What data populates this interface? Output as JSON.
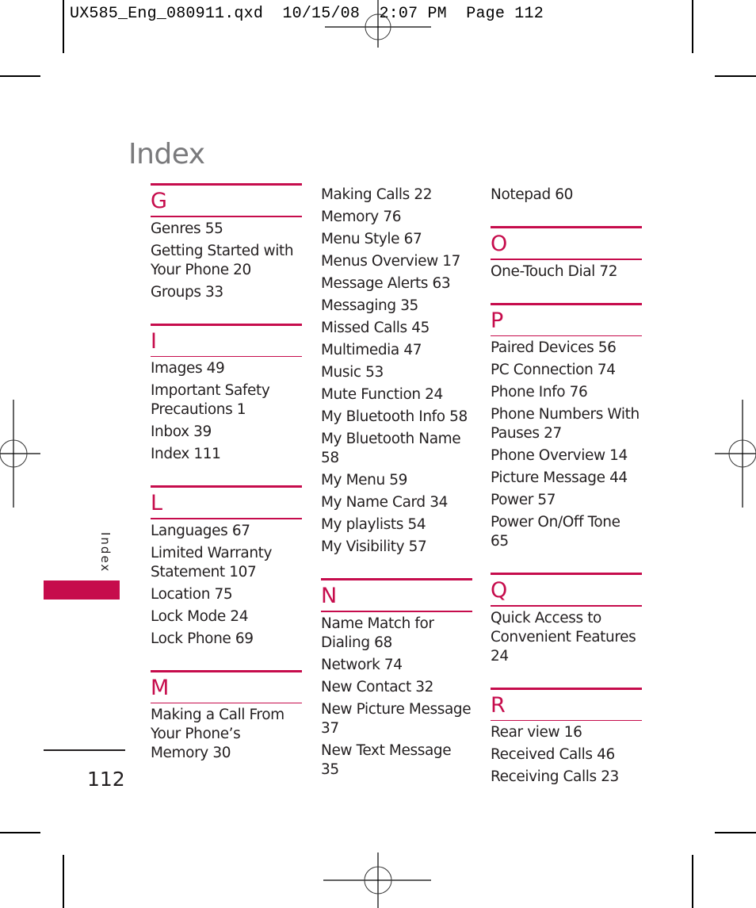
{
  "slug_line": "UX585_Eng_080911.qxd  10/15/08  2:07 PM  Page 112",
  "page_title": "Index",
  "sidebar": {
    "label": "Index",
    "accent_color": "#c60c4c"
  },
  "folio": "112",
  "columns": [
    {
      "lead_entries": [],
      "sections": [
        {
          "letter": "G",
          "entries": [
            "Genres 55",
            "Getting Started with Your Phone 20",
            "Groups 33"
          ]
        },
        {
          "letter": "I",
          "entries": [
            "Images 49",
            "Important Safety Precautions 1",
            "Inbox 39",
            "Index 111"
          ]
        },
        {
          "letter": "L",
          "entries": [
            "Languages 67",
            "Limited Warranty Statement 107",
            "Location 75",
            "Lock Mode 24",
            "Lock Phone 69"
          ]
        },
        {
          "letter": "M",
          "entries": [
            "Making a Call From Your Phone’s Memory 30"
          ]
        }
      ]
    },
    {
      "lead_entries": [
        "Making Calls 22",
        "Memory 76",
        "Menu Style 67",
        "Menus Overview 17",
        "Message Alerts 63",
        "Messaging 35",
        "Missed Calls 45",
        "Multimedia 47",
        "Music 53",
        "Mute Function 24",
        "My Bluetooth Info 58",
        "My Bluetooth Name 58",
        "My Menu 59",
        "My Name Card 34",
        "My playlists 54",
        "My Visibility 57"
      ],
      "sections": [
        {
          "letter": "N",
          "entries": [
            "Name Match for Dialing 68",
            "Network 74",
            "New Contact 32",
            "New Picture Message 37",
            "New Text Message 35"
          ]
        }
      ]
    },
    {
      "lead_entries": [
        "Notepad 60"
      ],
      "sections": [
        {
          "letter": "O",
          "entries": [
            "One-Touch Dial 72"
          ]
        },
        {
          "letter": "P",
          "entries": [
            "Paired Devices 56",
            "PC Connection 74",
            "Phone Info 76",
            "Phone Numbers With Pauses 27",
            "Phone Overview 14",
            "Picture Message 44",
            "Power 57",
            "Power On/Off Tone 65"
          ]
        },
        {
          "letter": "Q",
          "entries": [
            "Quick Access to Convenient Features 24"
          ]
        },
        {
          "letter": "R",
          "entries": [
            "Rear view 16",
            "Received Calls 46",
            "Receiving Calls 23"
          ]
        }
      ]
    }
  ]
}
